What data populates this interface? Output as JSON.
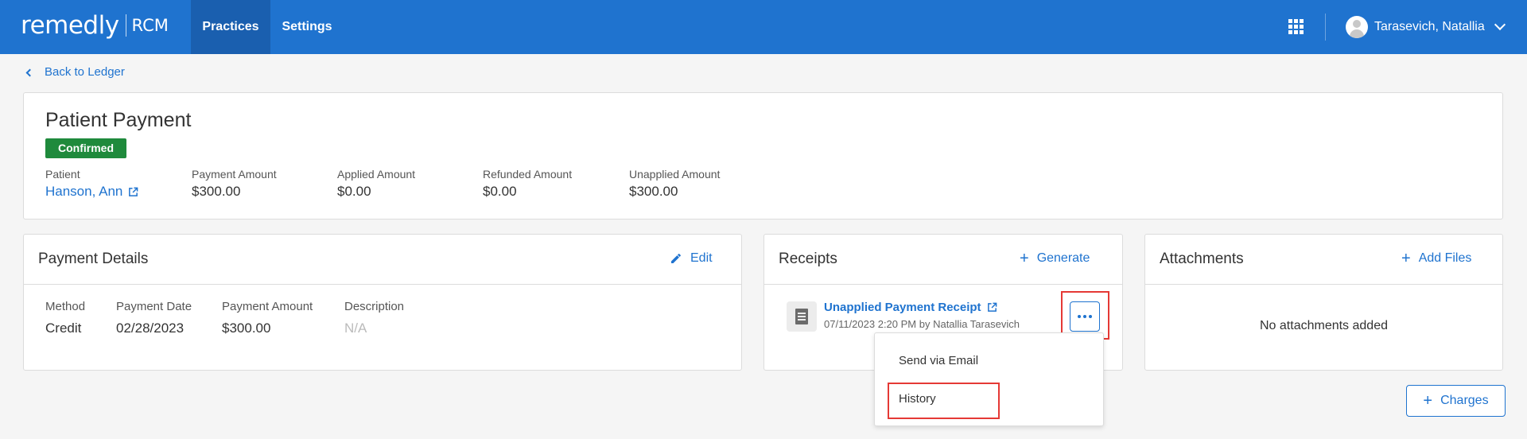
{
  "nav": {
    "logo_main": "remedly",
    "logo_sub": "RCM",
    "tabs": [
      {
        "label": "Practices",
        "active": true
      },
      {
        "label": "Settings",
        "active": false
      }
    ],
    "apps_icon": "grid-icon",
    "user_name": "Tarasevich, Natallia"
  },
  "back_link": "Back to Ledger",
  "summary": {
    "title": "Patient Payment",
    "status": "Confirmed",
    "status_color": "#1f8a3c",
    "fields": [
      {
        "label": "Patient",
        "value": "Hanson, Ann"
      },
      {
        "label": "Payment Amount",
        "value": "$300.00"
      },
      {
        "label": "Applied Amount",
        "value": "$0.00"
      },
      {
        "label": "Refunded Amount",
        "value": "$0.00"
      },
      {
        "label": "Unapplied Amount",
        "value": "$300.00"
      }
    ]
  },
  "payment_details": {
    "title": "Payment Details",
    "edit_label": "Edit",
    "columns": [
      {
        "label": "Method",
        "value": "Credit"
      },
      {
        "label": "Payment Date",
        "value": "02/28/2023"
      },
      {
        "label": "Payment Amount",
        "value": "$300.00"
      },
      {
        "label": "Description",
        "value": "N/A"
      }
    ]
  },
  "receipts": {
    "title": "Receipts",
    "generate_label": "Generate",
    "item": {
      "name": "Unapplied Payment Receipt",
      "meta": "07/11/2023 2:20 PM by Natallia Tarasevich"
    },
    "menu": [
      "Send via Email",
      "History"
    ]
  },
  "attachments": {
    "title": "Attachments",
    "add_label": "Add Files",
    "empty": "No attachments added"
  },
  "charges_label": "Charges",
  "colors": {
    "primary": "#1f73cf",
    "nav_bg": "#1f73cf",
    "highlight": "#e53935"
  }
}
